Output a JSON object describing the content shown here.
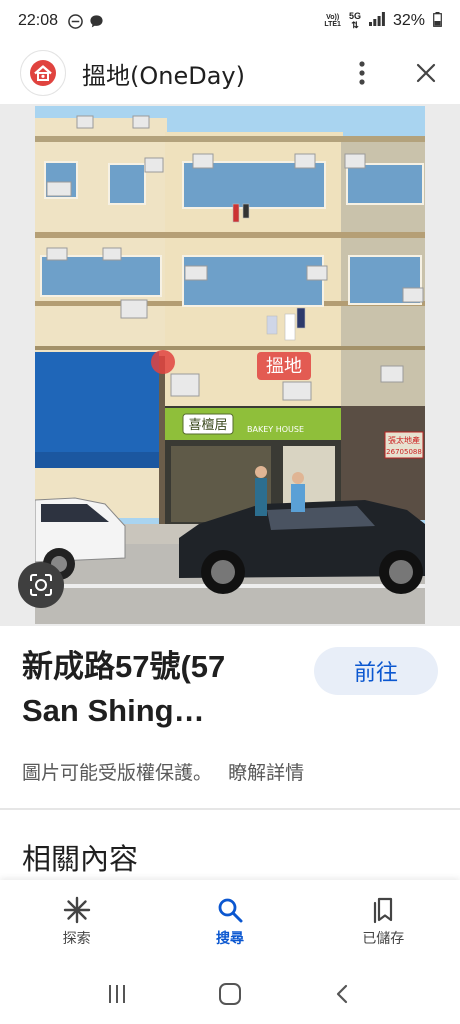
{
  "status_bar": {
    "time": "22:08",
    "net_top": "Vo))",
    "net_bottom": "LTE1",
    "signal_label": "5G",
    "battery": "32%"
  },
  "header": {
    "title": "搵地(OneDay)",
    "icons": [
      "site-logo-icon",
      "more-vert-icon",
      "close-icon"
    ]
  },
  "photo": {
    "shop_sign": "喜檀居",
    "shop_sign_sub": "BAKEY HOUSE",
    "watermark": "搵地",
    "side_sign_line1": "張太地產",
    "side_sign_line2": "26705088"
  },
  "info": {
    "title_line1": "新成路57號(57",
    "title_line2": "San Shing…",
    "go_button": "前往",
    "copyright": "圖片可能受版權保護。",
    "learn_more": "瞭解詳情",
    "related_heading": "相關內容"
  },
  "bottom_nav": {
    "items": [
      {
        "label": "探索",
        "icon": "explore-asterisk-icon",
        "active": false
      },
      {
        "label": "搜尋",
        "icon": "search-icon",
        "active": true
      },
      {
        "label": "已儲存",
        "icon": "saved-bookmarks-icon",
        "active": false
      }
    ],
    "active_color": "#0b57d0"
  },
  "colors": {
    "accent": "#0b57d0",
    "go_button_bg": "#e8eef8",
    "watermark_red": "#e0433f"
  }
}
